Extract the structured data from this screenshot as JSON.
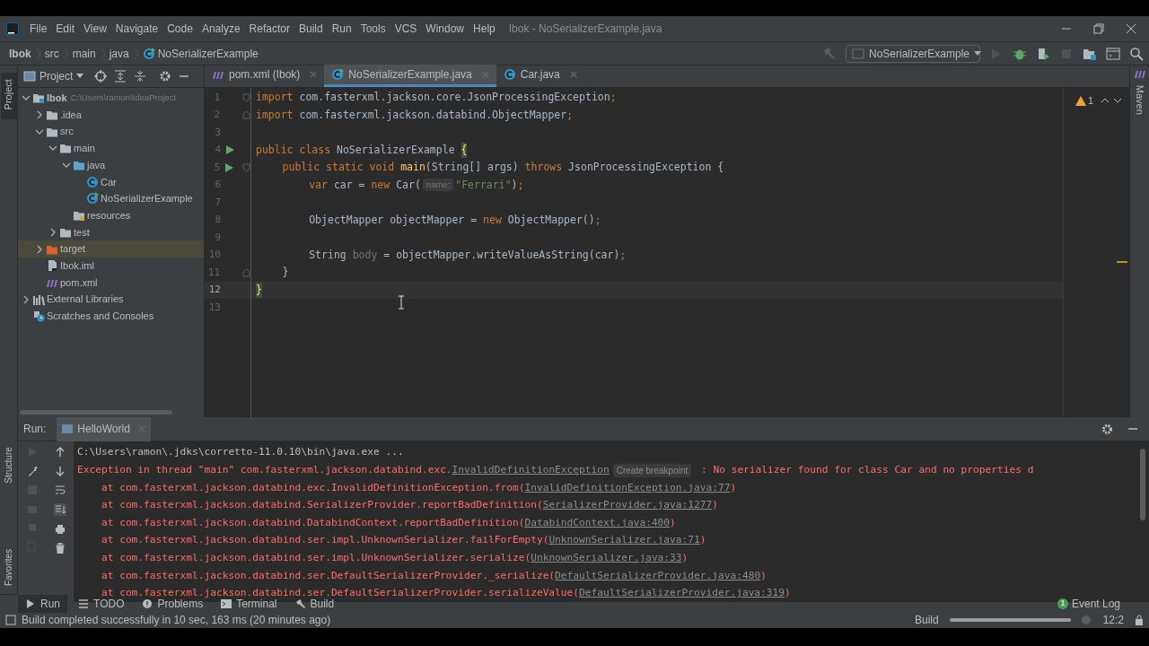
{
  "window": {
    "title": "Ibok - NoSerializerExample.java"
  },
  "menu": [
    "File",
    "Edit",
    "View",
    "Navigate",
    "Code",
    "Analyze",
    "Refactor",
    "Build",
    "Run",
    "Tools",
    "VCS",
    "Window",
    "Help"
  ],
  "breadcrumbs": [
    "Ibok",
    "src",
    "main",
    "java",
    "NoSerializerExample"
  ],
  "run_config": "NoSerializerExample",
  "toolbar": [
    {
      "kind": "run",
      "disabled": true
    },
    {
      "kind": "debug",
      "disabled": false
    },
    {
      "kind": "coverage",
      "disabled": false
    },
    {
      "kind": "stop",
      "disabled": true
    }
  ],
  "project_view": {
    "label": "Project"
  },
  "editor_tabs": [
    {
      "label": "pom.xml (Ibok)",
      "kind": "pom",
      "selected": false
    },
    {
      "label": "NoSerializerExample.java",
      "kind": "main",
      "selected": true
    },
    {
      "label": "Car.java",
      "kind": "class",
      "selected": false
    }
  ],
  "tree": [
    {
      "label": "Ibok",
      "hint": "C:\\Users\\ramon\\IdeaProject",
      "kind": "module",
      "expanded": true,
      "selected": false,
      "children": [
        {
          "label": ".idea",
          "kind": "folder",
          "expanded": false,
          "selected": false
        },
        {
          "label": "src",
          "kind": "folder",
          "expanded": true,
          "selected": false,
          "children": [
            {
              "label": "main",
              "kind": "folder",
              "expanded": true,
              "selected": false,
              "children": [
                {
                  "label": "java",
                  "kind": "source",
                  "expanded": true,
                  "selected": false,
                  "children": [
                    {
                      "label": "Car",
                      "kind": "class",
                      "selected": false
                    },
                    {
                      "label": "NoSerializerExample",
                      "kind": "main",
                      "selected": false
                    }
                  ]
                },
                {
                  "label": "resources",
                  "kind": "resources",
                  "selected": false
                }
              ]
            },
            {
              "label": "test",
              "kind": "folder",
              "expanded": false,
              "selected": false
            }
          ]
        },
        {
          "label": "target",
          "kind": "excluded",
          "expanded": false,
          "selected": true
        },
        {
          "label": "Ibok.iml",
          "kind": "iml",
          "selected": false
        },
        {
          "label": "pom.xml",
          "kind": "pom",
          "selected": false
        }
      ]
    },
    {
      "label": "External Libraries",
      "kind": "libraries",
      "expanded": false,
      "selected": false
    },
    {
      "label": "Scratches and Consoles",
      "kind": "scratches",
      "selected": false
    }
  ],
  "editor": {
    "warnings": "1",
    "lines": [
      {
        "number": "1",
        "run": false,
        "current": false,
        "segments": [
          {
            "kind": "keyword",
            "text": "import"
          },
          {
            "kind": "plain",
            "text": " com.fasterxml.jackson.core.JsonProcessingException"
          },
          {
            "kind": "keyword",
            "text": ";"
          }
        ]
      },
      {
        "number": "2",
        "run": false,
        "current": false,
        "segments": [
          {
            "kind": "keyword",
            "text": "import"
          },
          {
            "kind": "plain",
            "text": " com.fasterxml.jackson.databind.ObjectMapper"
          },
          {
            "kind": "keyword",
            "text": ";"
          }
        ]
      },
      {
        "number": "3",
        "run": false,
        "current": false
      },
      {
        "number": "4",
        "run": true,
        "current": false,
        "segments": [
          {
            "kind": "keyword",
            "text": "public class "
          },
          {
            "kind": "plain",
            "text": "NoSerializerExample "
          },
          {
            "kind": "brace",
            "text": "{"
          }
        ]
      },
      {
        "number": "5",
        "run": true,
        "current": false,
        "segments": [
          {
            "kind": "keyword",
            "text": "public static void "
          },
          {
            "kind": "method",
            "text": "main"
          },
          {
            "kind": "plain",
            "text": "(String[] args) "
          },
          {
            "kind": "keyword",
            "text": "throws "
          },
          {
            "kind": "plain",
            "text": "JsonProcessingException {"
          }
        ]
      },
      {
        "number": "6",
        "run": false,
        "current": false,
        "segments": [
          {
            "kind": "keyword",
            "text": "var "
          },
          {
            "kind": "plain",
            "text": "car = "
          },
          {
            "kind": "keyword",
            "text": "new "
          },
          {
            "kind": "plain",
            "text": "Car("
          },
          {
            "kind": "hint",
            "text": "name:"
          },
          {
            "kind": "string",
            "text": "\"Ferrari\""
          },
          {
            "kind": "plain",
            "text": ")"
          },
          {
            "kind": "keyword",
            "text": ";"
          }
        ]
      },
      {
        "number": "7",
        "run": false,
        "current": false
      },
      {
        "number": "8",
        "run": false,
        "current": false,
        "segments": [
          {
            "kind": "plain",
            "text": "ObjectMapper objectMapper = "
          },
          {
            "kind": "keyword",
            "text": "new "
          },
          {
            "kind": "plain",
            "text": "ObjectMapper()"
          },
          {
            "kind": "keyword",
            "text": ";"
          }
        ]
      },
      {
        "number": "9",
        "run": false,
        "current": false
      },
      {
        "number": "10",
        "run": false,
        "current": false,
        "segments": [
          {
            "kind": "plain",
            "text": "String "
          },
          {
            "kind": "unused",
            "text": "body"
          },
          {
            "kind": "plain",
            "text": " = objectMapper.writeValueAsString(car)"
          },
          {
            "kind": "keyword",
            "text": ";"
          }
        ]
      },
      {
        "number": "11",
        "run": false,
        "current": false,
        "segments": [
          {
            "kind": "plain",
            "text": "}"
          }
        ]
      },
      {
        "number": "12",
        "run": false,
        "current": true,
        "segments": [
          {
            "kind": "brace",
            "text": "}"
          }
        ]
      },
      {
        "number": "13",
        "run": false,
        "current": false
      }
    ]
  },
  "run_panel": {
    "label": "Run:",
    "tabs": [
      {
        "label": "HelloWorld",
        "selected": true
      }
    ],
    "lines": [
      [
        {
          "kind": "command",
          "text": "C:\\Users\\ramon\\.jdks\\corretto-11.0.10\\bin\\java.exe ..."
        }
      ],
      [
        {
          "kind": "error",
          "text": "Exception in thread \"main\" com.fasterxml.jackson.databind.exc."
        },
        {
          "kind": "link",
          "text": "InvalidDefinitionException"
        },
        {
          "kind": "hint",
          "text": "Create breakpoint"
        },
        {
          "kind": "error",
          "text": " : No serializer found for class Car and no properties d"
        }
      ],
      [
        {
          "kind": "error",
          "text": "    at com.fasterxml.jackson.databind.exc.InvalidDefinitionException.from("
        },
        {
          "kind": "link",
          "text": "InvalidDefinitionException.java:77"
        },
        {
          "kind": "error",
          "text": ")"
        }
      ],
      [
        {
          "kind": "error",
          "text": "    at com.fasterxml.jackson.databind.SerializerProvider.reportBadDefinition("
        },
        {
          "kind": "link",
          "text": "SerializerProvider.java:1277"
        },
        {
          "kind": "error",
          "text": ")"
        }
      ],
      [
        {
          "kind": "error",
          "text": "    at com.fasterxml.jackson.databind.DatabindContext.reportBadDefinition("
        },
        {
          "kind": "link",
          "text": "DatabindContext.java:400"
        },
        {
          "kind": "error",
          "text": ")"
        }
      ],
      [
        {
          "kind": "error",
          "text": "    at com.fasterxml.jackson.databind.ser.impl.UnknownSerializer.failForEmpty("
        },
        {
          "kind": "link",
          "text": "UnknownSerializer.java:71"
        },
        {
          "kind": "error",
          "text": ")"
        }
      ],
      [
        {
          "kind": "error",
          "text": "    at com.fasterxml.jackson.databind.ser.impl.UnknownSerializer.serialize("
        },
        {
          "kind": "link",
          "text": "UnknownSerializer.java:33"
        },
        {
          "kind": "error",
          "text": ")"
        }
      ],
      [
        {
          "kind": "error",
          "text": "    at com.fasterxml.jackson.databind.ser.DefaultSerializerProvider._serialize("
        },
        {
          "kind": "link",
          "text": "DefaultSerializerProvider.java:480"
        },
        {
          "kind": "error",
          "text": ")"
        }
      ],
      [
        {
          "kind": "error",
          "text": "    at com.fasterxml.jackson.databind.ser.DefaultSerializerProvider.serializeValue("
        },
        {
          "kind": "link",
          "text": "DefaultSerializerProvider.java:319"
        },
        {
          "kind": "error",
          "text": ")"
        }
      ]
    ]
  },
  "tool_windows": [
    {
      "label": "Run",
      "kind": "run",
      "selected": true
    },
    {
      "label": "TODO",
      "kind": "todo",
      "selected": false
    },
    {
      "label": "Problems",
      "kind": "problems",
      "selected": false
    },
    {
      "label": "Terminal",
      "kind": "terminal",
      "selected": false
    },
    {
      "label": "Build",
      "kind": "build",
      "selected": false
    }
  ],
  "side_labels": {
    "left_top": "Project",
    "left_structure": "Structure",
    "left_favorites": "Favorites",
    "right": "Maven"
  },
  "event_log": {
    "label": "Event Log",
    "count": "1"
  },
  "status_bar": {
    "message": "Build completed successfully in 10 sec, 163 ms (20 minutes ago)",
    "task": "Build",
    "level": 1,
    "position": "12:2"
  }
}
